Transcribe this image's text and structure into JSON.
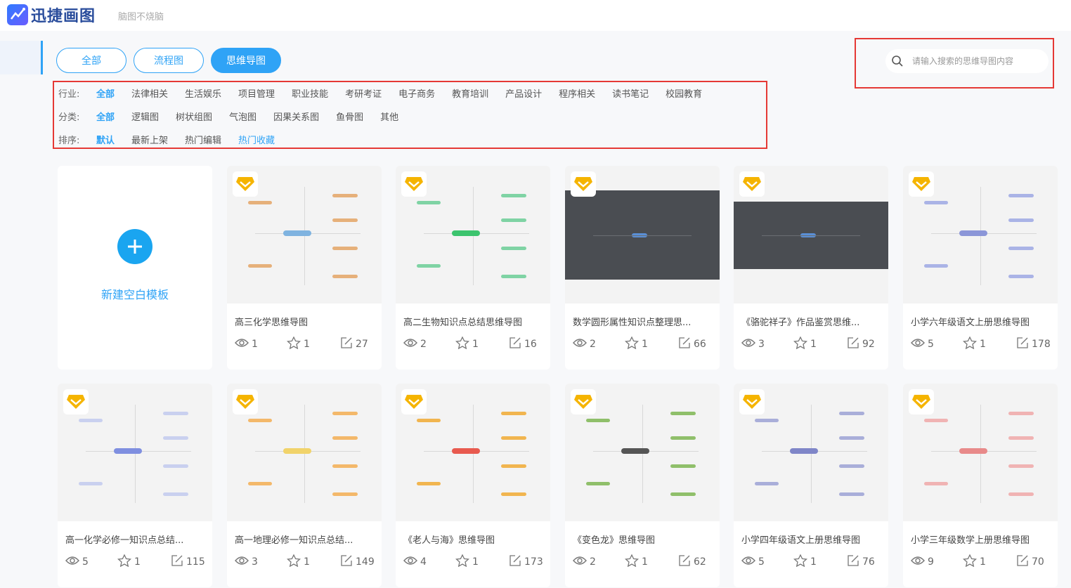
{
  "app": {
    "name": "迅捷画图",
    "slogan": "脑图不烧脑"
  },
  "tabs": [
    {
      "label": "全部",
      "active": false
    },
    {
      "label": "流程图",
      "active": false
    },
    {
      "label": "思维导图",
      "active": true
    }
  ],
  "search": {
    "placeholder": "请输入搜索的思维导图内容"
  },
  "filters": {
    "industry": {
      "label": "行业:",
      "options": [
        "全部",
        "法律相关",
        "生活娱乐",
        "项目管理",
        "职业技能",
        "考研考证",
        "电子商务",
        "教育培训",
        "产品设计",
        "程序相关",
        "读书笔记",
        "校园教育"
      ],
      "selected": "全部"
    },
    "category": {
      "label": "分类:",
      "options": [
        "全部",
        "逻辑图",
        "树状组图",
        "气泡图",
        "因果关系图",
        "鱼骨图",
        "其他"
      ],
      "selected": "全部"
    },
    "sort": {
      "label": "排序:",
      "options": [
        "默认",
        "最新上架",
        "热门编辑",
        "热门收藏"
      ],
      "selected": "默认"
    }
  },
  "new_template": {
    "label": "新建空白模板"
  },
  "templates": [
    {
      "title": "高三化学思维导图",
      "views": "1",
      "favs": "1",
      "edits": "27"
    },
    {
      "title": "高二生物知识点总结思维导图",
      "views": "2",
      "favs": "1",
      "edits": "16"
    },
    {
      "title": "数学圆形属性知识点整理思...",
      "views": "2",
      "favs": "1",
      "edits": "66"
    },
    {
      "title": "《骆驼祥子》作品鉴赏思维...",
      "views": "3",
      "favs": "1",
      "edits": "92"
    },
    {
      "title": "小学六年级语文上册思维导图",
      "views": "5",
      "favs": "1",
      "edits": "178"
    },
    {
      "title": "高一化学必修一知识点总结...",
      "views": "5",
      "favs": "1",
      "edits": "115"
    },
    {
      "title": "高一地理必修一知识点总结...",
      "views": "3",
      "favs": "1",
      "edits": "149"
    },
    {
      "title": "《老人与海》思维导图",
      "views": "4",
      "favs": "1",
      "edits": "173"
    },
    {
      "title": "《变色龙》思维导图",
      "views": "2",
      "favs": "1",
      "edits": "62"
    },
    {
      "title": "小学四年级语文上册思维导图",
      "views": "5",
      "favs": "1",
      "edits": "76"
    },
    {
      "title": "小学三年级数学上册思维导图",
      "views": "9",
      "favs": "1",
      "edits": "70"
    }
  ],
  "colors": {
    "accent": "#2fa3f6",
    "highlight_box": "#e53935",
    "badge": "#f5b400"
  }
}
